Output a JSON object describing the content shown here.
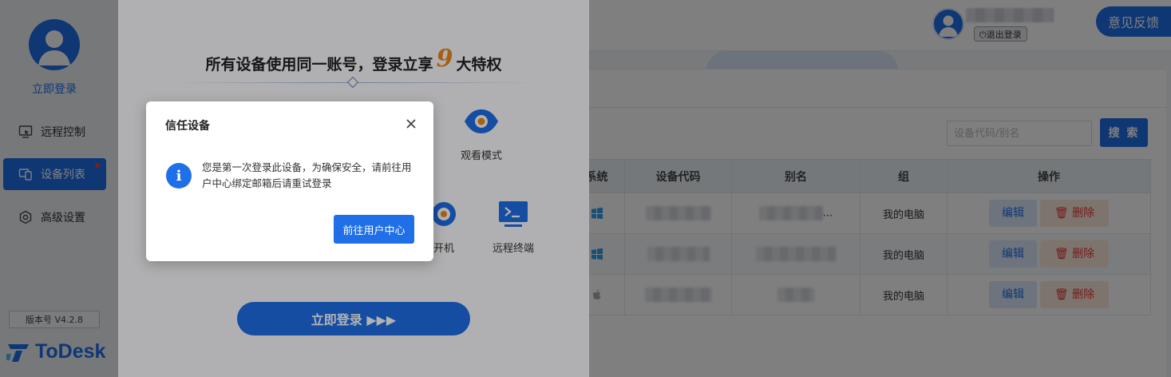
{
  "sidebar": {
    "login_label": "立即登录",
    "items": [
      {
        "label": "远程控制",
        "icon": "monitor-cursor-icon"
      },
      {
        "label": "设备列表",
        "icon": "devices-icon",
        "active": true,
        "badge": true
      },
      {
        "label": "高级设置",
        "icon": "settings-icon"
      }
    ],
    "version": "版本号 V4.2.8",
    "brand": "ToDesk"
  },
  "header": {
    "logout_label": "⏻退出登录",
    "feedback_label": "意见反馈"
  },
  "search": {
    "placeholder": "设备代码/别名",
    "button_label": "搜 索"
  },
  "table": {
    "columns": [
      "系统",
      "设备代码",
      "别名",
      "组",
      "操作"
    ],
    "rows": [
      {
        "os": "windows-icon",
        "alias_suffix": "...",
        "group": "我的电脑",
        "edit": "编辑",
        "delete": "删除"
      },
      {
        "os": "windows-icon",
        "alias_suffix": "",
        "group": "我的电脑",
        "edit": "编辑",
        "delete": "删除"
      },
      {
        "os": "apple-icon",
        "alias_suffix": "",
        "group": "我的电脑",
        "edit": "编辑",
        "delete": "删除"
      }
    ]
  },
  "promo": {
    "title_pre": "所有设备使用同一账号，登录立享",
    "title_num": "9",
    "title_post": "大特权",
    "features": [
      {
        "label": "观看模式",
        "icon": "eye-icon"
      },
      {
        "label": "开机",
        "icon": "power-on-icon"
      },
      {
        "label": "远程终端",
        "icon": "terminal-icon"
      }
    ],
    "login_button": "立即登录 ▶▶▶"
  },
  "dialog": {
    "title": "信任设备",
    "message": "您是第一次登录此设备，为确保安全，请前往用户中心绑定邮箱后请重试登录",
    "button": "前往用户中心"
  },
  "colors": {
    "accent": "#1e6fe8",
    "danger": "#e53935",
    "brand_orange": "#f08a1c"
  }
}
